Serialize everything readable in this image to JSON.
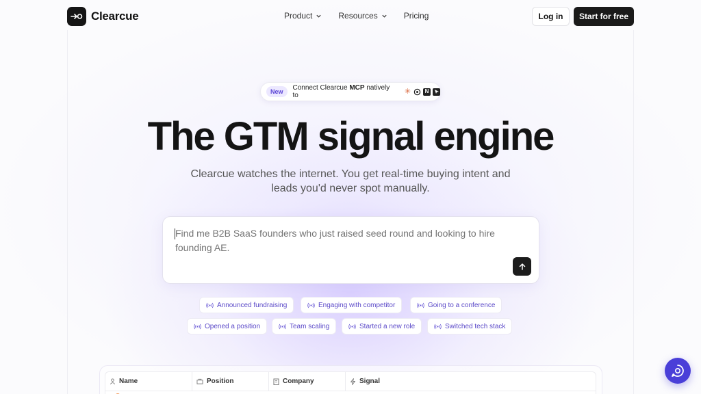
{
  "brand": {
    "name": "Clearcue"
  },
  "nav": {
    "items": [
      {
        "label": "Product",
        "dropdown": true
      },
      {
        "label": "Resources",
        "dropdown": true
      },
      {
        "label": "Pricing",
        "dropdown": false
      }
    ],
    "login_label": "Log in",
    "start_label": "Start for free"
  },
  "badge": {
    "tag": "New",
    "text_prefix": "Connect Clearcue ",
    "text_bold": "MCP",
    "text_suffix": " natively to",
    "icons": [
      "claude-icon",
      "openai-icon",
      "notion-icon",
      "cursor-icon"
    ]
  },
  "hero": {
    "title": "The GTM signal engine",
    "subtitle": "Clearcue watches the internet. You get real-time buying intent and leads you'd never spot manually."
  },
  "search": {
    "placeholder": "Find me B2B SaaS founders who just raised seed round and looking to hire founding AE."
  },
  "chips": [
    "Announced fundraising",
    "Engaging with competitor",
    "Going to a conference",
    "Opened a position",
    "Team scaling",
    "Started a new role",
    "Switched tech stack"
  ],
  "table": {
    "columns": [
      {
        "label": "Name",
        "icon": "person-icon"
      },
      {
        "label": "Position",
        "icon": "briefcase-icon"
      },
      {
        "label": "Company",
        "icon": "building-icon"
      },
      {
        "label": "Signal",
        "icon": "bolt-icon"
      }
    ]
  },
  "colors": {
    "accent": "#5a48c8",
    "dark": "#1a1a1a",
    "chat": "#4a3fd8"
  }
}
